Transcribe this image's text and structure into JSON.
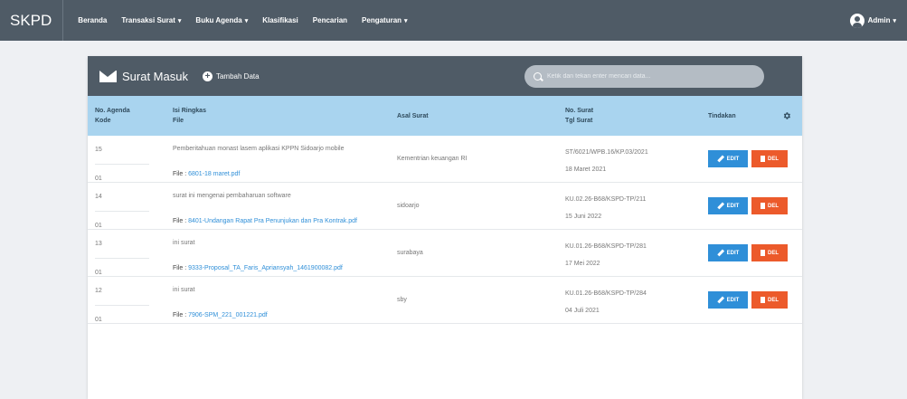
{
  "app": {
    "brand": "SKPD"
  },
  "nav": {
    "items": [
      {
        "label": "Beranda",
        "has_caret": false
      },
      {
        "label": "Transaksi Surat",
        "has_caret": true
      },
      {
        "label": "Buku Agenda",
        "has_caret": true
      },
      {
        "label": "Klasifikasi",
        "has_caret": false
      },
      {
        "label": "Pencarian",
        "has_caret": false
      },
      {
        "label": "Pengaturan",
        "has_caret": true
      }
    ],
    "user": "Admin",
    "caret": "▾"
  },
  "panel": {
    "title": "Surat Masuk",
    "add_label": "Tambah Data",
    "search_placeholder": "Ketik dan tekan enter mencari data..."
  },
  "table": {
    "headers": {
      "agenda": "No. Agenda",
      "kode": "Kode",
      "isi": "Isi Ringkas",
      "file": "File",
      "asal": "Asal Surat",
      "nosurat": "No. Surat",
      "tgl": "Tgl Surat",
      "tindakan": "Tindakan"
    },
    "file_prefix": "File :",
    "edit_label": "EDIT",
    "del_label": "DEL",
    "rows": [
      {
        "agenda": "15",
        "kode": "01",
        "isi": "Pemberitahuan monast lasem aplikasi KPPN Sidoarjo mobile",
        "file": "6801-18 maret.pdf",
        "asal": "Kementrian keuangan RI",
        "nosurat": "ST/6021/WPB.16/KP.03/2021",
        "tgl": "18 Maret 2021"
      },
      {
        "agenda": "14",
        "kode": "01",
        "isi": "surat ini mengenai pembaharuan software",
        "file": "8401-Undangan Rapat Pra Penunjukan dan Pra Kontrak.pdf",
        "asal": "sidoarjo",
        "nosurat": "KU.02.26-B68/KSPD-TP/211",
        "tgl": "15 Juni 2022"
      },
      {
        "agenda": "13",
        "kode": "01",
        "isi": "ini surat",
        "file": "9333-Proposal_TA_Faris_Apriansyah_1461900082.pdf",
        "asal": "surabaya",
        "nosurat": "KU.01.26-B68/KSPD-TP/281",
        "tgl": "17 Mei 2022"
      },
      {
        "agenda": "12",
        "kode": "01",
        "isi": "ini surat",
        "file": "7906-SPM_221_001221.pdf",
        "asal": "sby",
        "nosurat": "KU.01.26-B68/KSPD-TP/284",
        "tgl": "04 Juli 2021"
      }
    ]
  },
  "colors": {
    "navbar": "#4f5b66",
    "header": "#a9d4ef",
    "edit": "#2f8fd8",
    "delete": "#ec5a2b"
  }
}
